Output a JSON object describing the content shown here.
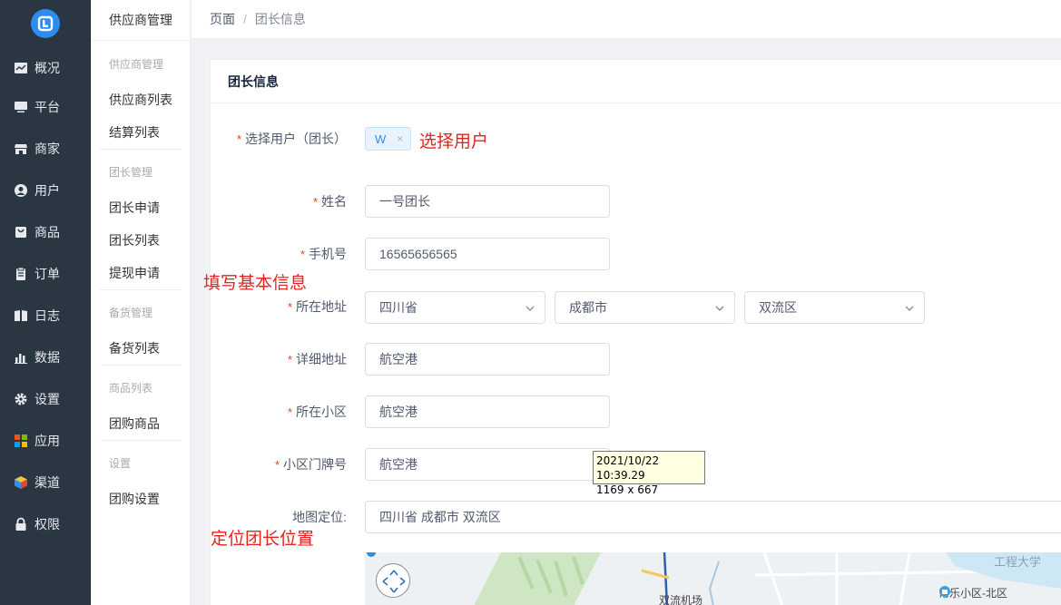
{
  "rail": {
    "items": [
      {
        "label": "概况",
        "icon": "chart-icon"
      },
      {
        "label": "平台",
        "icon": "monitor-icon"
      },
      {
        "label": "商家",
        "icon": "store-icon"
      },
      {
        "label": "用户",
        "icon": "user-icon"
      },
      {
        "label": "商品",
        "icon": "bag-icon"
      },
      {
        "label": "订单",
        "icon": "clipboard-icon"
      },
      {
        "label": "日志",
        "icon": "book-icon"
      },
      {
        "label": "数据",
        "icon": "bar-chart-icon"
      },
      {
        "label": "设置",
        "icon": "gear-icon"
      },
      {
        "label": "应用",
        "icon": "apps-icon"
      },
      {
        "label": "渠道",
        "icon": "cube-icon"
      },
      {
        "label": "权限",
        "icon": "lock-icon"
      }
    ]
  },
  "submenu": {
    "title": "供应商管理",
    "groups": [
      {
        "title": "供应商管理",
        "items": [
          "供应商列表",
          "结算列表"
        ]
      },
      {
        "title": "团长管理",
        "items": [
          "团长申请",
          "团长列表",
          "提现申请"
        ]
      },
      {
        "title": "备货管理",
        "items": [
          "备货列表"
        ]
      },
      {
        "title": "商品列表",
        "items": [
          "团购商品"
        ]
      },
      {
        "title": "设置",
        "items": [
          "团购设置"
        ]
      }
    ]
  },
  "breadcrumb": {
    "root": "页面",
    "sep": "/",
    "current": "团长信息"
  },
  "card": {
    "title": "团长信息"
  },
  "form": {
    "user_label": "选择用户（团长）",
    "user_tag": "W",
    "user_tag_close": "×",
    "name_label": "姓名",
    "name_value": "一号团长",
    "phone_label": "手机号",
    "phone_value": "16565656565",
    "region_label": "所在地址",
    "province": "四川省",
    "city": "成都市",
    "district": "双流区",
    "address_label": "详细地址",
    "address_value": "航空港",
    "community_label": "所在小区",
    "community_value": "航空港",
    "door_label": "小区门牌号",
    "door_value": "航空港",
    "map_label": "地图定位:",
    "map_value": "四川省 成都市 双流区"
  },
  "notes": {
    "select_user": "选择用户",
    "fill_basic": "填写基本信息",
    "locate": "定位团长位置"
  },
  "tooltip": {
    "line1": "2021/10/22 10:39.29",
    "line2": "1169 x 667"
  },
  "map": {
    "labels": {
      "univ": "工程大学",
      "community": "常乐小区-北区",
      "airport": "双流机场"
    }
  }
}
